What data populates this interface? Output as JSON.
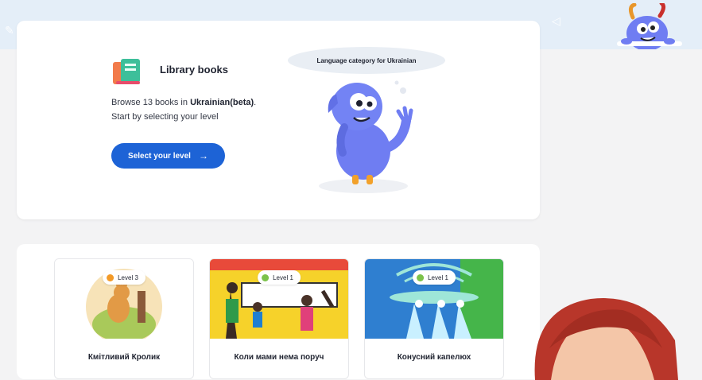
{
  "hero": {
    "title": "Library books",
    "desc_prefix": "Browse 13 books in ",
    "desc_language": "Ukrainian(beta)",
    "desc_suffix": ".",
    "desc_line2": "Start by selecting your level",
    "button_label": "Select your level",
    "button_arrow": "→",
    "bubble_text": "Language category for Ukrainian"
  },
  "books": [
    {
      "title": "Кмітливий Кролик",
      "level": "Level 3",
      "level_color": "#f39a27"
    },
    {
      "title": "Коли мами нема поруч",
      "level": "Level 1",
      "level_color": "#7cc24a"
    },
    {
      "title": "Конусний капелюх",
      "level": "Level 1",
      "level_color": "#7cc24a"
    }
  ],
  "colors": {
    "accent": "#1d63d6",
    "top_band": "#e4eef8",
    "monster": "#6f7df2"
  },
  "icons": [
    "book-stack-icon",
    "arrow-right-icon",
    "monster-mascot",
    "level-dot-icon"
  ]
}
